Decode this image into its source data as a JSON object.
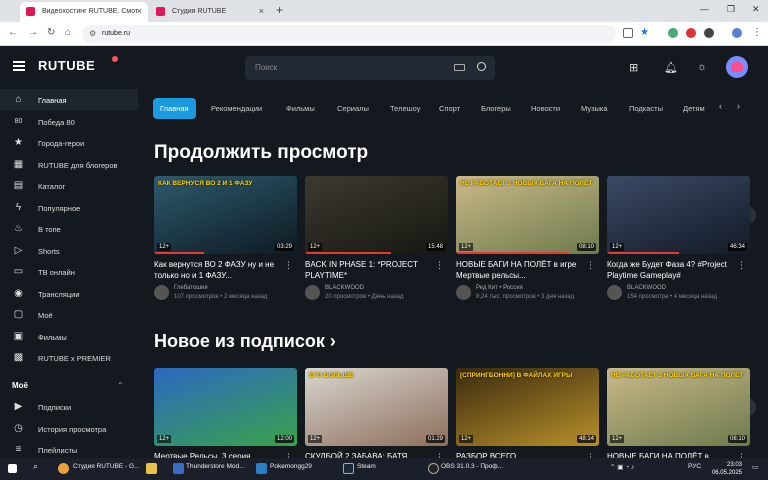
{
  "browser": {
    "tabs": [
      {
        "label": "Видеохостинг RUTUBE. Смот"
      },
      {
        "label": "Студия RUTUBE"
      }
    ],
    "new_tab": "+",
    "window_controls": {
      "minimize": "—",
      "maximize": "❐",
      "close": "✕"
    },
    "url": "rutube.ru"
  },
  "header": {
    "logo": "RUTUBE",
    "search_placeholder": "Поиск"
  },
  "sidebar": {
    "items": [
      {
        "label": "Главная",
        "icon": "home-icon",
        "glyph": "⌂"
      },
      {
        "label": "Победа 80",
        "icon": "victory-80-icon",
        "glyph": "80"
      },
      {
        "label": "Города-герои",
        "icon": "star-icon",
        "glyph": "★"
      },
      {
        "label": "RUTUBE для блогеров",
        "icon": "grid-icon",
        "glyph": "▦"
      },
      {
        "label": "Каталог",
        "icon": "catalog-icon",
        "glyph": "▤"
      },
      {
        "label": "Популярное",
        "icon": "lightning-icon",
        "glyph": "ϟ"
      },
      {
        "label": "В топе",
        "icon": "fire-icon",
        "glyph": "♨"
      },
      {
        "label": "Shorts",
        "icon": "shorts-icon",
        "glyph": "▷"
      },
      {
        "label": "ТВ онлайн",
        "icon": "tv-icon",
        "glyph": "▭"
      },
      {
        "label": "Трансляции",
        "icon": "broadcast-icon",
        "glyph": "◉"
      },
      {
        "label": "Моё",
        "icon": "folder-icon",
        "glyph": "▢"
      },
      {
        "label": "Фильмы",
        "icon": "film-icon",
        "glyph": "▣"
      },
      {
        "label": "RUTUBE x PREMIER",
        "icon": "premier-icon",
        "glyph": "▩"
      }
    ],
    "my_section": {
      "heading": "Моё",
      "items": [
        {
          "label": "Подписки",
          "icon": "subscriptions-icon",
          "glyph": "▶"
        },
        {
          "label": "История просмотра",
          "icon": "history-icon",
          "glyph": "◷"
        },
        {
          "label": "Плейлисты",
          "icon": "playlist-icon",
          "glyph": "≡"
        }
      ]
    }
  },
  "categories": [
    "Главная",
    "Рекомендации",
    "Фильмы",
    "Сериалы",
    "Телешоу",
    "Спорт",
    "Блогеры",
    "Новости",
    "Музыка",
    "Подкасты",
    "Детям"
  ],
  "sections": [
    {
      "title": "Продолжить просмотр",
      "videos": [
        {
          "title": "Как вернутся ВО 2 ФАЗУ ну и не только но и 1 ФАЗУ...",
          "age": "12+",
          "duration": "03:29",
          "progress": 0.35,
          "channel": "Глебатошия",
          "views": "107 просмотров",
          "ago": "2 месяца назад",
          "thumb_text": "КАК ВЕРНУСЯ ВО 2 И 1 ФАЗУ",
          "colors": [
            "#2e5a6e",
            "#0e1a22"
          ]
        },
        {
          "title": "BACK IN PHASE 1: *PROJECT PLAYTIME*",
          "age": "12+",
          "duration": "15:48",
          "progress": 0.6,
          "channel": "BLACKWOOD",
          "views": "20 просмотров",
          "ago": "День назад",
          "thumb_text": "",
          "colors": [
            "#3c3a30",
            "#171712"
          ]
        },
        {
          "title": "НОВЫЕ БАГИ НА ПОЛЁТ в игре Мертвые рельсы...",
          "age": "12+",
          "duration": "08:10",
          "progress": 0.8,
          "channel": "Ред Кит • Россия",
          "views": "8,24 тыс. просмотров",
          "ago": "3 дня назад",
          "thumb_text": "НЕ РАБОТАЕТ  3 НОВЫХ БАГА НА ПОЛЁТ",
          "colors": [
            "#c9b98a",
            "#6e7a4c"
          ]
        },
        {
          "title": "Когда же Будет Фаза 4? #Project Playtime Gameplay#",
          "age": "12+",
          "duration": "46:34",
          "progress": 0.5,
          "channel": "BLACKWOOD",
          "views": "154 просмотра",
          "ago": "4 месяца назад",
          "thumb_text": "",
          "colors": [
            "#3a4a66",
            "#141a26"
          ]
        }
      ]
    },
    {
      "title": "Новое из подписок ›",
      "videos": [
        {
          "title": "Мертвые Рельсы. 3 серия",
          "age": "12+",
          "duration": "12:00",
          "thumb_text": "",
          "colors": [
            "#2b68c2",
            "#3aa24a"
          ]
        },
        {
          "title": "СКУЛБОЙ 2 ЗАБАВА: БАТЯ",
          "age": "12+",
          "duration": "01:29",
          "thumb_text": "ЕГО БОЛЬШЕ",
          "colors": [
            "#d8d6d0",
            "#8d6e5a"
          ]
        },
        {
          "title": "РАЗБОР ВСЕГО",
          "age": "12+",
          "duration": "48:14",
          "thumb_text": "[СПРИНГБОННИ] В ФАЙЛАХ ИГРЫ",
          "colors": [
            "#3a2a10",
            "#b8902a"
          ]
        },
        {
          "title": "НОВЫЕ БАГИ НА ПОЛЁТ в",
          "age": "12+",
          "duration": "08:10",
          "thumb_text": "НЕ РАБОТАЕТ  3 НОВЫХ БАГА НА ПОЛЁТ",
          "colors": [
            "#c9b98a",
            "#6e7a4c"
          ]
        }
      ]
    }
  ],
  "taskbar": {
    "apps": [
      {
        "label": "Студия RUTUBE - G..."
      },
      {
        "label": "Thunderstore Mod..."
      },
      {
        "label": "Pokemongg29"
      },
      {
        "label": "Steam"
      },
      {
        "label": "OBS 31.0.3 - Проф..."
      }
    ],
    "lang": "РУС",
    "time": "23:03",
    "date": "06.05.2025"
  },
  "colors": {
    "accent": "#1a9be0",
    "bg": "#14191f",
    "progress": "#e53935"
  }
}
